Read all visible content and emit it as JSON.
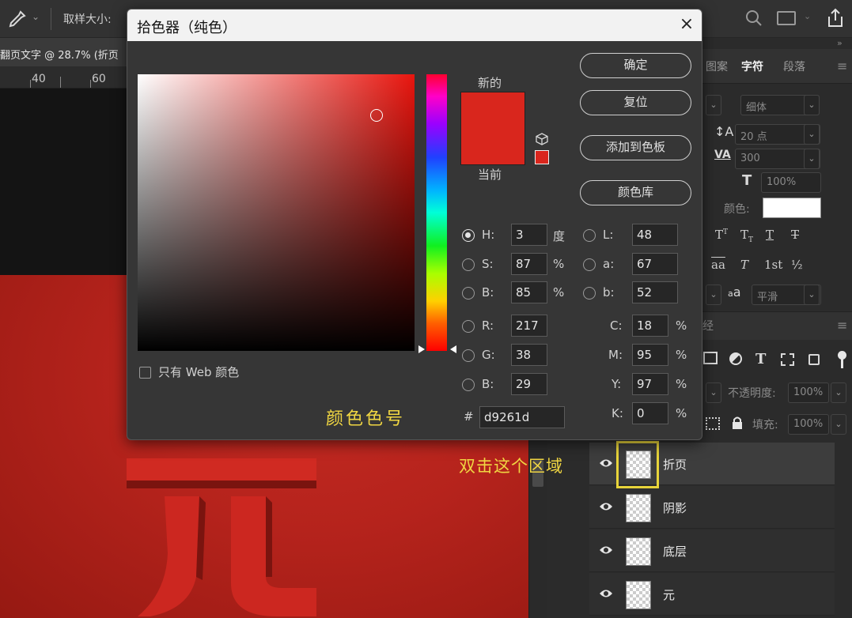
{
  "topbar": {
    "sample_label": "取样大小:"
  },
  "document": {
    "tab_title": "翻页文字 @ 28.7% (折页",
    "ruler": [
      "40",
      "60"
    ],
    "canvas_text": "元"
  },
  "dialog": {
    "title": "拾色器（纯色）",
    "close": "×",
    "new_label": "新的",
    "current_label": "当前",
    "new_color": "#d9261d",
    "buttons": {
      "ok": "确定",
      "reset": "复位",
      "add_swatch": "添加到色板",
      "color_library": "颜色库"
    },
    "fields": {
      "H": {
        "label": "H:",
        "value": "3",
        "unit": "度"
      },
      "S": {
        "label": "S:",
        "value": "87",
        "unit": "%"
      },
      "Bv": {
        "label": "B:",
        "value": "85",
        "unit": "%"
      },
      "R": {
        "label": "R:",
        "value": "217"
      },
      "G": {
        "label": "G:",
        "value": "38"
      },
      "Bc": {
        "label": "B:",
        "value": "29"
      },
      "L": {
        "label": "L:",
        "value": "48"
      },
      "a": {
        "label": "a:",
        "value": "67"
      },
      "b": {
        "label": "b:",
        "value": "52"
      },
      "C": {
        "label": "C:",
        "value": "18",
        "unit": "%"
      },
      "M": {
        "label": "M:",
        "value": "95",
        "unit": "%"
      },
      "Y": {
        "label": "Y:",
        "value": "97",
        "unit": "%"
      },
      "K": {
        "label": "K:",
        "value": "0",
        "unit": "%"
      },
      "hex": {
        "label": "#",
        "value": "d9261d"
      }
    },
    "web_only": "只有 Web 颜色",
    "annotation": "颜色色号"
  },
  "panels": {
    "tabs": [
      "图案",
      "字符",
      "段落"
    ],
    "font_style": "细体",
    "font_size": "20 点",
    "tracking": "300",
    "scale": "100%",
    "color_label": "颜色:",
    "type_styles": [
      "T",
      "T",
      "T",
      "T"
    ],
    "opentype": [
      "aa",
      "T",
      "1st",
      "½"
    ],
    "aa_label": "a",
    "aa_value": "平滑",
    "layers_partial_title": "经",
    "opacity_label": "不透明度:",
    "opacity_value": "100%",
    "fill_label": "填充:",
    "fill_value": "100%"
  },
  "layers": [
    {
      "name": "折页",
      "selected": true
    },
    {
      "name": "阴影",
      "selected": false
    },
    {
      "name": "底层",
      "selected": false
    },
    {
      "name": "元",
      "selected": false
    }
  ],
  "annotation_layer": "双击这个区域"
}
